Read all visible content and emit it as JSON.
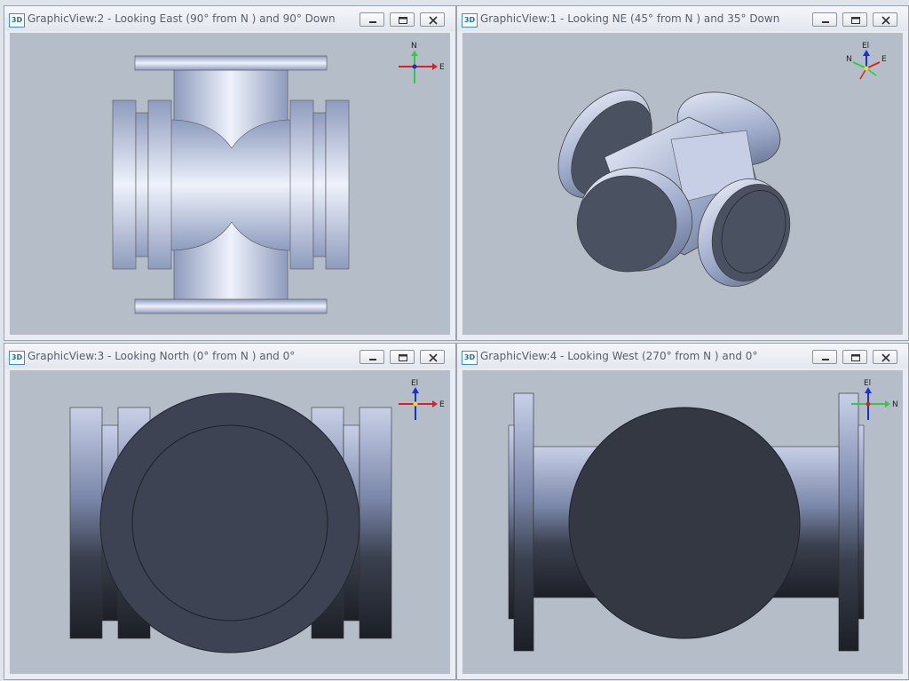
{
  "panes": [
    {
      "badge": "3D",
      "title": "GraphicView:2 - Looking East (90° from N ) and 90° Down",
      "axes": {
        "up": "N",
        "right": "E"
      }
    },
    {
      "badge": "3D",
      "title": "GraphicView:1 - Looking NE (45° from N ) and 35° Down",
      "axes": {
        "up": "El",
        "left": "N",
        "right": "E"
      }
    },
    {
      "badge": "3D",
      "title": "GraphicView:3 - Looking North (0° from N ) and 0°",
      "axes": {
        "up": "El",
        "right": "E"
      }
    },
    {
      "badge": "3D",
      "title": "GraphicView:4 - Looking West (270° from N ) and 0°",
      "axes": {
        "up": "El",
        "right": "N"
      }
    }
  ],
  "colors": {
    "viewport_bg": "#b5bdc9",
    "metal_light": "#eef2fb",
    "metal_mid": "#9aa7c8",
    "face_dark": "#3d4352",
    "axis_north": "#2ecc40",
    "axis_east": "#e02020",
    "axis_elev": "#1a2fd0"
  },
  "icons": {
    "badge": "3d-view-icon",
    "minimize": "minimize-icon",
    "restore": "restore-icon",
    "close": "close-icon"
  }
}
